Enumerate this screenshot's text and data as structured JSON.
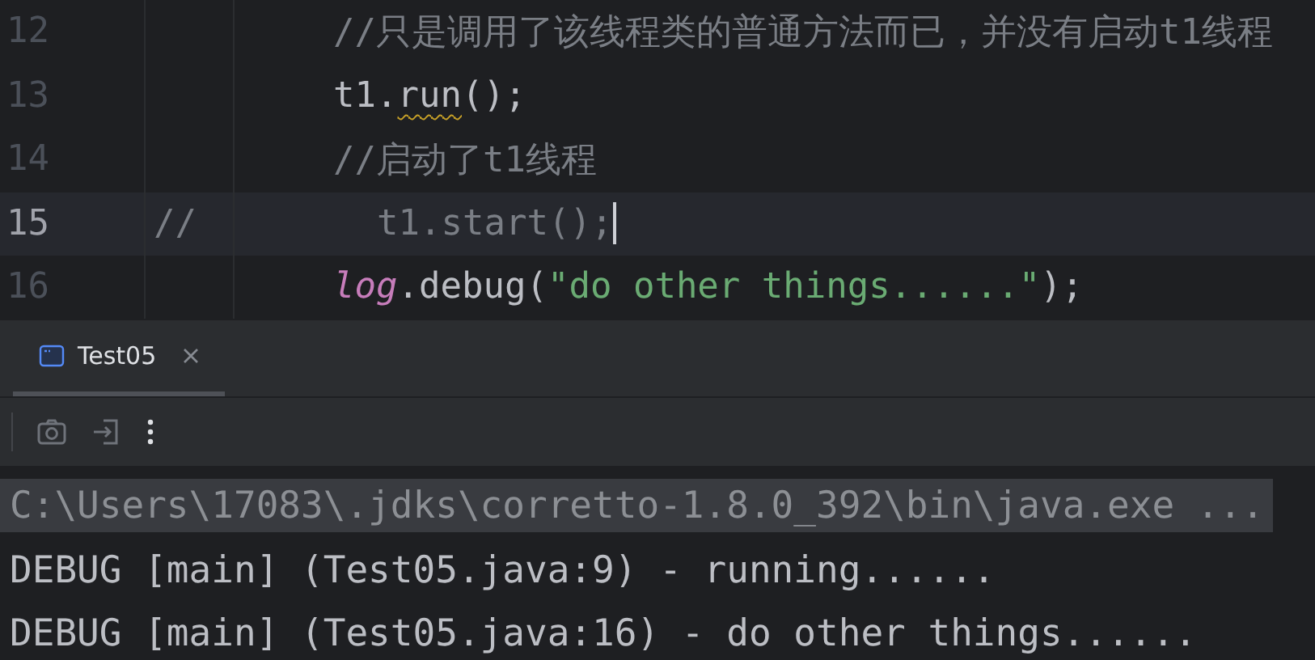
{
  "editor": {
    "lines": [
      {
        "number": "12",
        "current": false,
        "tokens": [
          {
            "text": "//只是调用了该线程类的普通方法而已，并没有启动t1线程",
            "kind": "comment"
          }
        ]
      },
      {
        "number": "13",
        "current": false,
        "tokens": [
          {
            "text": "t1.",
            "kind": "plain"
          },
          {
            "text": "run",
            "kind": "warning"
          },
          {
            "text": "();",
            "kind": "plain"
          }
        ]
      },
      {
        "number": "14",
        "current": false,
        "tokens": [
          {
            "text": "//启动了t1线程",
            "kind": "comment"
          }
        ]
      },
      {
        "number": "15",
        "current": true,
        "marker": "//",
        "tokens": [
          {
            "text": "t1.start();",
            "kind": "commented"
          }
        ]
      },
      {
        "number": "16",
        "current": false,
        "tokens": [
          {
            "text": "log",
            "kind": "field"
          },
          {
            "text": ".debug(",
            "kind": "plain"
          },
          {
            "text": "\"do other things......\"",
            "kind": "string"
          },
          {
            "text": ");",
            "kind": "plain"
          }
        ]
      }
    ]
  },
  "run_tabs": [
    {
      "label": "Test05",
      "selected": true
    }
  ],
  "console": {
    "lines": [
      {
        "text": "C:\\Users\\17083\\.jdks\\corretto-1.8.0_392\\bin\\java.exe ...",
        "kind": "command"
      },
      {
        "text": "DEBUG [main] (Test05.java:9) - running......",
        "kind": "output"
      },
      {
        "text": "DEBUG [main] (Test05.java:16) - do other things......",
        "kind": "output"
      }
    ]
  }
}
